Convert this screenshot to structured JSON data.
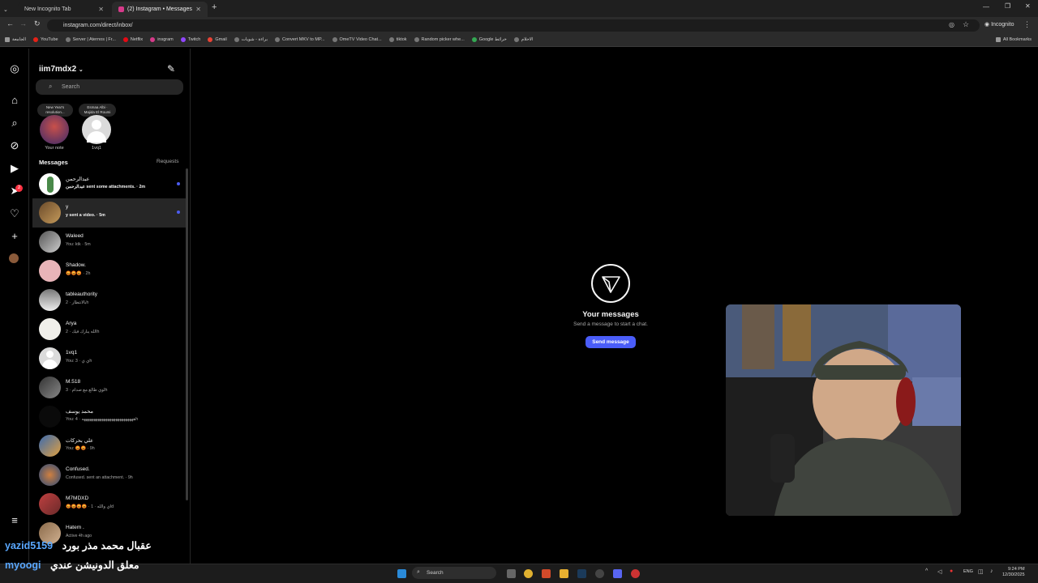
{
  "browser": {
    "tabs": [
      {
        "label": "New Incognito Tab"
      },
      {
        "label": "(2) Instagram • Messages"
      }
    ],
    "url": "instagram.com/direct/inbox/",
    "profile_label": "Incognito",
    "bookmarks": [
      "الجامعة",
      "YouTube",
      "Server | Aternos | Fr...",
      "Netflix",
      "insgram",
      "Twitch",
      "Gmail",
      "براءة - شويات",
      "Convert MKV to MP...",
      "OmeTV Video Chat...",
      "tiktok",
      "Random picker whe...",
      "Google خرائط",
      "الاحلام"
    ],
    "all_bookmarks": "All Bookmarks"
  },
  "instagram": {
    "username": "iim7mdx2",
    "search_placeholder": "Search",
    "notes": [
      {
        "bubble": "New Year's resolution...",
        "label": "Your note"
      },
      {
        "bubble": "Esmaa Albi · Majida El Roumi",
        "label": "1vq1"
      }
    ],
    "messages_title": "Messages",
    "requests_label": "Requests",
    "rail_badge": "2",
    "chats": [
      {
        "name": "عبدالرحمن",
        "preview": "عبدالرحمن sent some attachments. · 2m",
        "unread": true
      },
      {
        "name": "y",
        "preview": "y sent a video. · 5m",
        "unread": true
      },
      {
        "name": "Waleed",
        "preview": "You: ktk · 5m",
        "unread": false
      },
      {
        "name": "Shadow.",
        "preview": "😡😡😡 · 2h",
        "unread": false
      },
      {
        "name": "tableauthority",
        "preview": "بالانتظار · 2h",
        "unread": false
      },
      {
        "name": "Arya",
        "preview": "الله يبارك فيك · 2h",
        "unread": false
      },
      {
        "name": "1vq1",
        "preview": "You: ي ي · 3h",
        "unread": false
      },
      {
        "name": "M.518",
        "preview": "لوي طالع مع صدام · 3h",
        "unread": false
      },
      {
        "name": "محمد يوسف",
        "preview": "You: ههههههههههههههههههههههههههه · 4h",
        "unread": false
      },
      {
        "name": "علي بحركات",
        "preview": "You: 😡😡 · 9h",
        "unread": false
      },
      {
        "name": "Confused.",
        "preview": "Confused. sent an attachment. · 9h",
        "unread": false
      },
      {
        "name": "M7MDXD",
        "preview": "😡😡😡😡 · اي والله · 1d",
        "unread": false
      },
      {
        "name": "Hatem .",
        "preview": "Active 4h ago",
        "unread": false
      }
    ],
    "empty_state": {
      "title": "Your messages",
      "subtitle": "Send a message to start a chat.",
      "button": "Send message"
    }
  },
  "taskbar": {
    "search": "Search",
    "lang": "ENG",
    "time": "9:24 PM",
    "date": "12/30/2025"
  },
  "overlay": {
    "line1_name": "yazid5159",
    "line1_msg": "عقبال محمد مذر بورد",
    "line2_name": "myoogi",
    "line2_msg": "معلق الدونيشن عندي"
  }
}
